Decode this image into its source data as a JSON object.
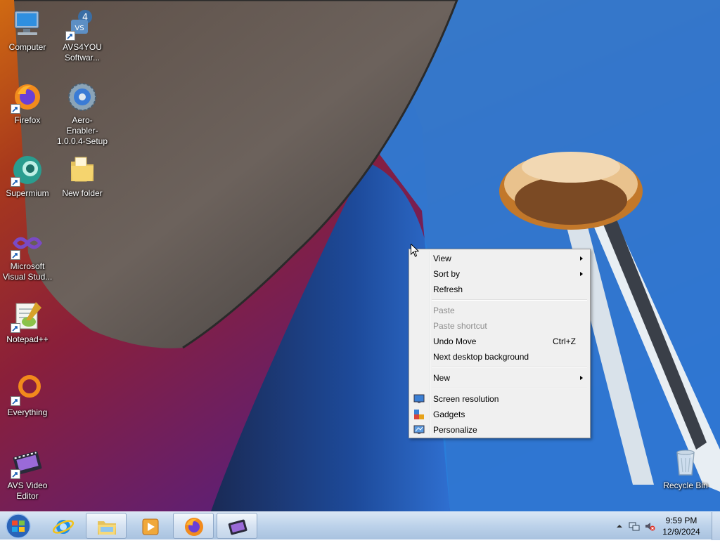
{
  "desktop_icons": [
    {
      "label": "Computer",
      "icon": "computer-icon"
    },
    {
      "label": "AVS4YOU Softwar...",
      "icon": "avs4you-icon"
    },
    {
      "label": "Firefox",
      "icon": "firefox-icon"
    },
    {
      "label": "Aero-Enabler-1.0.0.4-Setup",
      "icon": "setup-gear-icon"
    },
    {
      "label": "Supermium",
      "icon": "supermium-icon"
    },
    {
      "label": "New folder",
      "icon": "folder-icon"
    },
    {
      "label": "Microsoft Visual Stud...",
      "icon": "visual-studio-icon"
    },
    {
      "label": "Notepad++",
      "icon": "notepadpp-icon"
    },
    {
      "label": "Everything",
      "icon": "everything-icon"
    },
    {
      "label": "AVS Video Editor",
      "icon": "avs-video-editor-icon"
    },
    {
      "label": "Recycle Bin",
      "icon": "recycle-bin-icon"
    }
  ],
  "context_menu": {
    "items": [
      {
        "label": "View",
        "submenu": true
      },
      {
        "label": "Sort by",
        "submenu": true
      },
      {
        "label": "Refresh"
      },
      {
        "label": "Paste",
        "disabled": true
      },
      {
        "label": "Paste shortcut",
        "disabled": true
      },
      {
        "label": "Undo Move",
        "shortcut": "Ctrl+Z"
      },
      {
        "label": "Next desktop background"
      },
      {
        "label": "New",
        "submenu": true
      },
      {
        "label": "Screen resolution",
        "icon": "screen-resolution-icon"
      },
      {
        "label": "Gadgets",
        "icon": "gadgets-icon"
      },
      {
        "label": "Personalize",
        "icon": "personalize-icon"
      }
    ]
  },
  "taskbar": {
    "items": [
      {
        "name": "Internet Explorer",
        "icon": "internet-explorer-icon",
        "state": "pinned"
      },
      {
        "name": "Windows Explorer",
        "icon": "file-explorer-icon",
        "state": "running"
      },
      {
        "name": "Windows Media Player",
        "icon": "media-player-icon",
        "state": "pinned"
      },
      {
        "name": "Firefox",
        "icon": "firefox-icon",
        "state": "running"
      },
      {
        "name": "AVS Video Editor",
        "icon": "avs-video-editor-icon",
        "state": "running"
      }
    ],
    "clock": {
      "time": "9:59 PM",
      "date": "12/9/2024"
    }
  },
  "colors": {
    "menu_bg": "#f0f0f0",
    "taskbar": "#bcd2ea",
    "sky": "#2b86e2"
  }
}
